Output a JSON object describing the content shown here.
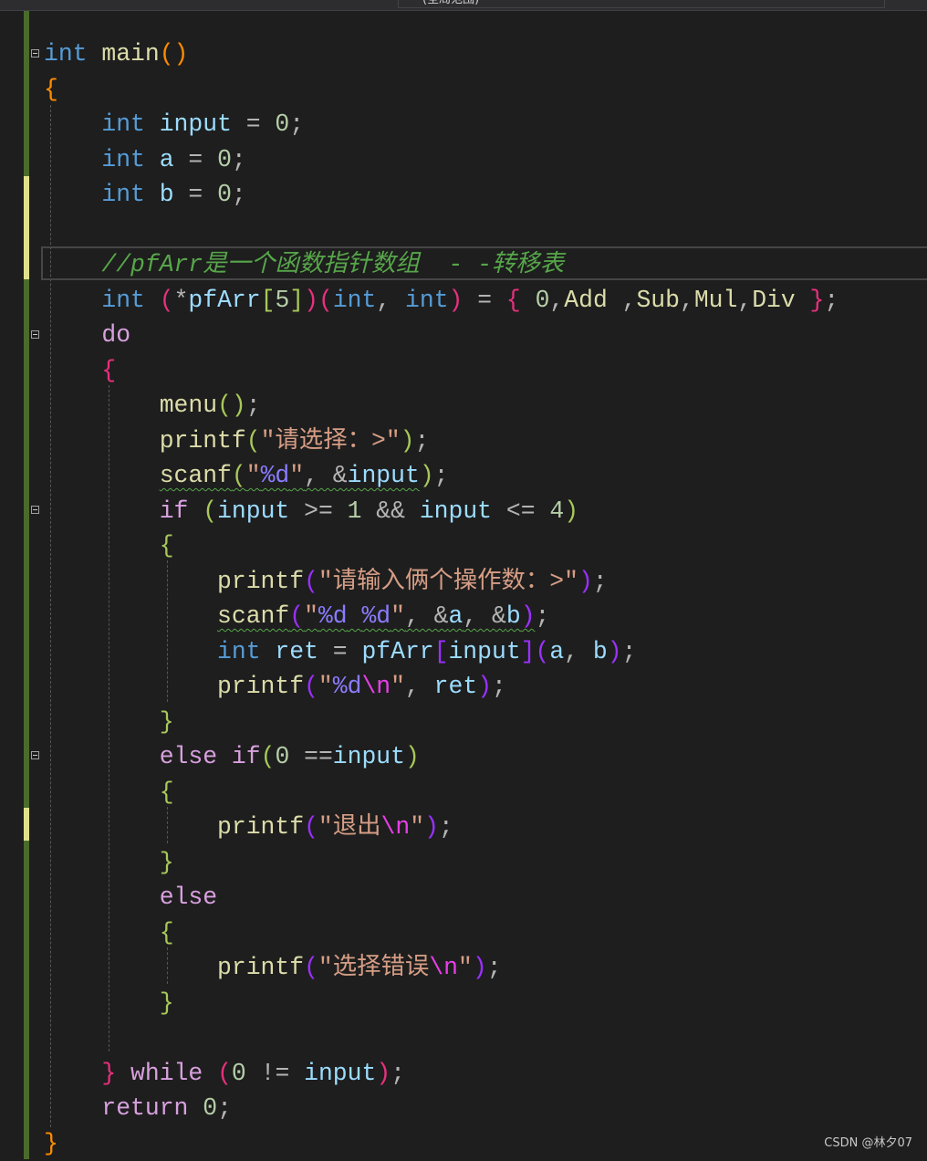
{
  "editor": {
    "scope_label": "(全局范围)",
    "watermark": "CSDN @林夕07",
    "colors": {
      "keyword": "#569cd6",
      "function": "#dcdcaa",
      "variable": "#9cdcfe",
      "number": "#b5cea8",
      "string": "#d69d85",
      "comment": "#57a64a",
      "control": "#d8a0df"
    }
  },
  "code": {
    "lines": [
      {
        "indent": 0,
        "tokens": [
          [
            "int",
            "kw"
          ],
          [
            " ",
            "op"
          ],
          [
            "main",
            "fn"
          ],
          [
            "()",
            "p1"
          ]
        ]
      },
      {
        "indent": 0,
        "tokens": [
          [
            "{",
            "p1"
          ]
        ]
      },
      {
        "indent": 4,
        "tokens": [
          [
            "int",
            "kw"
          ],
          [
            " ",
            "op"
          ],
          [
            "input",
            "var"
          ],
          [
            " = ",
            "op"
          ],
          [
            "0",
            "num"
          ],
          [
            ";",
            "op"
          ]
        ]
      },
      {
        "indent": 4,
        "tokens": [
          [
            "int",
            "kw"
          ],
          [
            " ",
            "op"
          ],
          [
            "a",
            "var"
          ],
          [
            " = ",
            "op"
          ],
          [
            "0",
            "num"
          ],
          [
            ";",
            "op"
          ]
        ]
      },
      {
        "indent": 4,
        "tokens": [
          [
            "int",
            "kw"
          ],
          [
            " ",
            "op"
          ],
          [
            "b",
            "var"
          ],
          [
            " = ",
            "op"
          ],
          [
            "0",
            "num"
          ],
          [
            ";",
            "op"
          ]
        ]
      },
      {
        "indent": 0,
        "tokens": []
      },
      {
        "indent": 4,
        "tokens": [
          [
            "//pfArr是一个函数指针数组  - -转移表",
            "cm"
          ]
        ]
      },
      {
        "indent": 4,
        "tokens": [
          [
            "int",
            "kw"
          ],
          [
            " ",
            "op"
          ],
          [
            "(",
            "p2"
          ],
          [
            "*",
            "op"
          ],
          [
            "pfArr",
            "var"
          ],
          [
            "[",
            "p3"
          ],
          [
            "5",
            "num"
          ],
          [
            "]",
            "p3"
          ],
          [
            ")",
            "p2"
          ],
          [
            "(",
            "p2"
          ],
          [
            "int",
            "kw"
          ],
          [
            ", ",
            "op"
          ],
          [
            "int",
            "kw"
          ],
          [
            ")",
            "p2"
          ],
          [
            " = ",
            "op"
          ],
          [
            "{",
            "p2"
          ],
          [
            " ",
            "op"
          ],
          [
            "0",
            "num"
          ],
          [
            ",",
            "op"
          ],
          [
            "Add",
            "fn"
          ],
          [
            " ,",
            "op"
          ],
          [
            "Sub",
            "fn"
          ],
          [
            ",",
            "op"
          ],
          [
            "Mul",
            "fn"
          ],
          [
            ",",
            "op"
          ],
          [
            "Div",
            "fn"
          ],
          [
            " ",
            "op"
          ],
          [
            "}",
            "p2"
          ],
          [
            ";",
            "op"
          ]
        ]
      },
      {
        "indent": 4,
        "tokens": [
          [
            "do",
            "ctl"
          ]
        ]
      },
      {
        "indent": 4,
        "tokens": [
          [
            "{",
            "p2"
          ]
        ]
      },
      {
        "indent": 8,
        "tokens": [
          [
            "menu",
            "fn"
          ],
          [
            "()",
            "p3"
          ],
          [
            ";",
            "op"
          ]
        ]
      },
      {
        "indent": 8,
        "tokens": [
          [
            "printf",
            "fn"
          ],
          [
            "(",
            "p3"
          ],
          [
            "\"请选择：>\"",
            "str"
          ],
          [
            ")",
            "p3"
          ],
          [
            ";",
            "op"
          ]
        ]
      },
      {
        "indent": 8,
        "squiggle": 6,
        "tokens": [
          [
            "scanf",
            "fn"
          ],
          [
            "(",
            "p3"
          ],
          [
            "\"",
            "str"
          ],
          [
            "%d",
            "fmt"
          ],
          [
            "\"",
            "str"
          ],
          [
            ", &",
            "op"
          ],
          [
            "input",
            "var"
          ],
          [
            ")",
            "p3"
          ],
          [
            ";",
            "op"
          ]
        ]
      },
      {
        "indent": 8,
        "tokens": [
          [
            "if",
            "ctl"
          ],
          [
            " ",
            "op"
          ],
          [
            "(",
            "p3"
          ],
          [
            "input",
            "var"
          ],
          [
            " >= ",
            "op"
          ],
          [
            "1",
            "num"
          ],
          [
            " && ",
            "op"
          ],
          [
            "input",
            "var"
          ],
          [
            " <= ",
            "op"
          ],
          [
            "4",
            "num"
          ],
          [
            ")",
            "p3"
          ]
        ]
      },
      {
        "indent": 8,
        "tokens": [
          [
            "{",
            "p3"
          ]
        ]
      },
      {
        "indent": 12,
        "tokens": [
          [
            "printf",
            "fn"
          ],
          [
            "(",
            "p4"
          ],
          [
            "\"请输入俩个操作数：>\"",
            "str"
          ],
          [
            ")",
            "p4"
          ],
          [
            ";",
            "op"
          ]
        ]
      },
      {
        "indent": 12,
        "squiggle": 11,
        "tokens": [
          [
            "scanf",
            "fn"
          ],
          [
            "(",
            "p4"
          ],
          [
            "\"",
            "str"
          ],
          [
            "%d",
            "fmt"
          ],
          [
            " ",
            "str"
          ],
          [
            "%d",
            "fmt"
          ],
          [
            "\"",
            "str"
          ],
          [
            ", &",
            "op"
          ],
          [
            "a",
            "var"
          ],
          [
            ", &",
            "op"
          ],
          [
            "b",
            "var"
          ],
          [
            ")",
            "p4"
          ],
          [
            ";",
            "op"
          ]
        ]
      },
      {
        "indent": 12,
        "tokens": [
          [
            "int",
            "kw"
          ],
          [
            " ",
            "op"
          ],
          [
            "ret",
            "var"
          ],
          [
            " = ",
            "op"
          ],
          [
            "pfArr",
            "var"
          ],
          [
            "[",
            "p4"
          ],
          [
            "input",
            "var"
          ],
          [
            "]",
            "p4"
          ],
          [
            "(",
            "p4"
          ],
          [
            "a",
            "var"
          ],
          [
            ", ",
            "op"
          ],
          [
            "b",
            "var"
          ],
          [
            ")",
            "p4"
          ],
          [
            ";",
            "op"
          ]
        ]
      },
      {
        "indent": 12,
        "tokens": [
          [
            "printf",
            "fn"
          ],
          [
            "(",
            "p4"
          ],
          [
            "\"",
            "str"
          ],
          [
            "%d",
            "fmt"
          ],
          [
            "\\n",
            "esc"
          ],
          [
            "\"",
            "str"
          ],
          [
            ", ",
            "op"
          ],
          [
            "ret",
            "var"
          ],
          [
            ")",
            "p4"
          ],
          [
            ";",
            "op"
          ]
        ]
      },
      {
        "indent": 8,
        "tokens": [
          [
            "}",
            "p3"
          ]
        ]
      },
      {
        "indent": 8,
        "tokens": [
          [
            "else",
            "ctl"
          ],
          [
            " ",
            "op"
          ],
          [
            "if",
            "ctl"
          ],
          [
            "(",
            "p3"
          ],
          [
            "0",
            "num"
          ],
          [
            " ==",
            "op"
          ],
          [
            "input",
            "var"
          ],
          [
            ")",
            "p3"
          ]
        ]
      },
      {
        "indent": 8,
        "tokens": [
          [
            "{",
            "p3"
          ]
        ]
      },
      {
        "indent": 12,
        "tokens": [
          [
            "printf",
            "fn"
          ],
          [
            "(",
            "p4"
          ],
          [
            "\"退出",
            "str"
          ],
          [
            "\\n",
            "esc"
          ],
          [
            "\"",
            "str"
          ],
          [
            ")",
            "p4"
          ],
          [
            ";",
            "op"
          ]
        ]
      },
      {
        "indent": 8,
        "tokens": [
          [
            "}",
            "p3"
          ]
        ]
      },
      {
        "indent": 8,
        "tokens": [
          [
            "else",
            "ctl"
          ]
        ]
      },
      {
        "indent": 8,
        "tokens": [
          [
            "{",
            "p3"
          ]
        ]
      },
      {
        "indent": 12,
        "tokens": [
          [
            "printf",
            "fn"
          ],
          [
            "(",
            "p4"
          ],
          [
            "\"选择错误",
            "str"
          ],
          [
            "\\n",
            "esc"
          ],
          [
            "\"",
            "str"
          ],
          [
            ")",
            "p4"
          ],
          [
            ";",
            "op"
          ]
        ]
      },
      {
        "indent": 8,
        "tokens": [
          [
            "}",
            "p3"
          ]
        ]
      },
      {
        "indent": 0,
        "tokens": []
      },
      {
        "indent": 4,
        "tokens": [
          [
            "}",
            "p2"
          ],
          [
            " ",
            "op"
          ],
          [
            "while",
            "ctl"
          ],
          [
            " ",
            "op"
          ],
          [
            "(",
            "p2"
          ],
          [
            "0",
            "num"
          ],
          [
            " != ",
            "op"
          ],
          [
            "input",
            "var"
          ],
          [
            ")",
            "p2"
          ],
          [
            ";",
            "op"
          ]
        ]
      },
      {
        "indent": 4,
        "tokens": [
          [
            "return",
            "ctl"
          ],
          [
            " ",
            "op"
          ],
          [
            "0",
            "num"
          ],
          [
            ";",
            "op"
          ]
        ]
      },
      {
        "indent": 0,
        "tokens": [
          [
            "}",
            "p1"
          ]
        ]
      }
    ]
  }
}
